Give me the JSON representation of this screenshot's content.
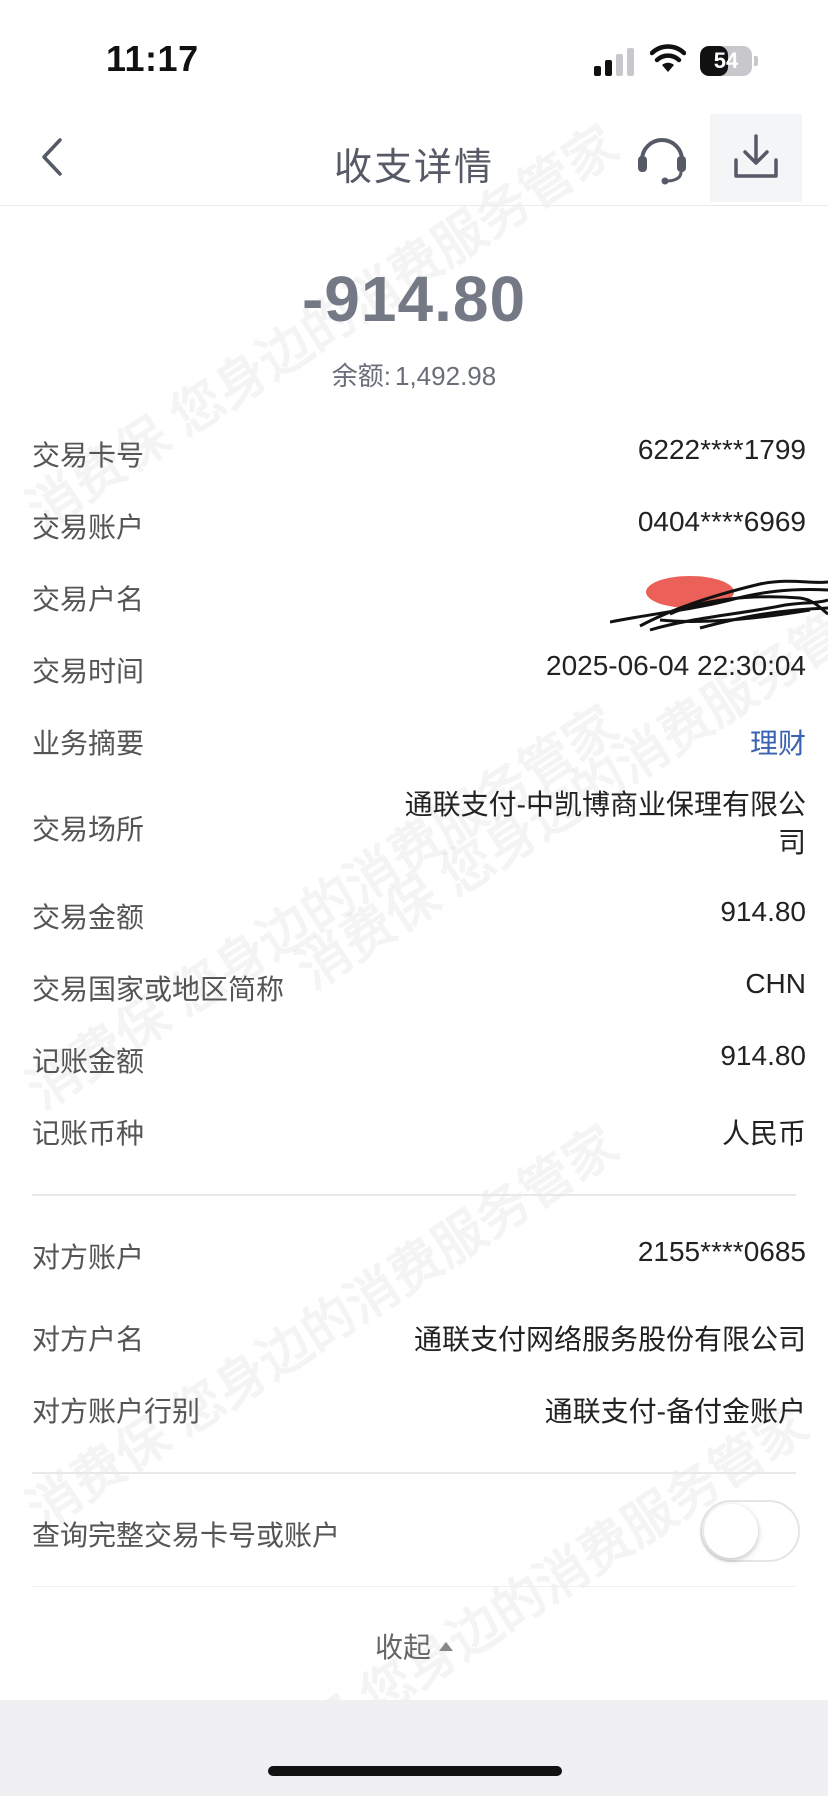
{
  "status_bar": {
    "time": "11:17",
    "battery_level": "54",
    "signal_bars_active": 2,
    "signal_bars_total": 4
  },
  "nav": {
    "title": "收支详情",
    "back_icon": "chevron-left-icon",
    "service_icon": "headset-icon",
    "download_icon": "download-icon"
  },
  "summary": {
    "amount": "-914.80",
    "balance_label": "余额:",
    "balance_value": "1,492.98"
  },
  "details": [
    {
      "label": "交易卡号",
      "value": "6222****1799"
    },
    {
      "label": "交易账户",
      "value": "0404****6969"
    },
    {
      "label": "交易户名",
      "value": ""
    },
    {
      "label": "交易时间",
      "value": "2025-06-04 22:30:04"
    },
    {
      "label": "业务摘要",
      "value": "理财"
    },
    {
      "label": "交易场所",
      "value": "通联支付-中凯博商业保理有限公司"
    },
    {
      "label": "交易金额",
      "value": "914.80"
    },
    {
      "label": "交易国家或地区简称",
      "value": "CHN"
    },
    {
      "label": "记账金额",
      "value": "914.80"
    },
    {
      "label": "记账币种",
      "value": "人民币"
    }
  ],
  "counterparty": [
    {
      "label": "对方账户",
      "value": "2155****0685"
    },
    {
      "label": "对方户名",
      "value": "通联支付网络服务股份有限公司"
    },
    {
      "label": "对方账户行别",
      "value": "通联支付-备付金账户"
    }
  ],
  "query_toggle": {
    "label": "查询完整交易卡号或账户",
    "enabled": false
  },
  "collapse_label": "收起",
  "watermark_text": "消费保 您身边的消费服务管家",
  "colors": {
    "link": "#3a62b2",
    "amount": "#757985",
    "redaction_red": "#e8453c"
  }
}
